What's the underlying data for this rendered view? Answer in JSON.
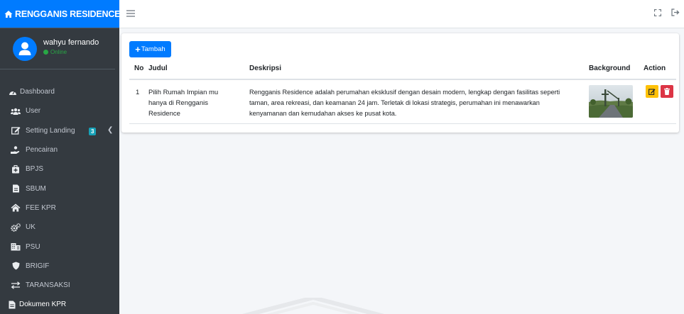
{
  "brand": {
    "title": "RENGGANIS RESIDENCE"
  },
  "user": {
    "name": "wahyu fernando",
    "status": "Online"
  },
  "sidebar": {
    "items": [
      {
        "label": "Dashboard",
        "icon": "tachometer-icon"
      },
      {
        "label": "User",
        "icon": "users-icon"
      },
      {
        "label": "Setting Landing",
        "icon": "edit-icon",
        "badge": "3"
      },
      {
        "label": "Pencairan",
        "icon": "hand-holding-icon"
      },
      {
        "label": "BPJS",
        "icon": "medkit-icon"
      },
      {
        "label": "SBUM",
        "icon": "file-icon"
      },
      {
        "label": "FEE KPR",
        "icon": "home-icon"
      },
      {
        "label": "UK",
        "icon": "cogs-icon"
      },
      {
        "label": "PSU",
        "icon": "building-icon"
      },
      {
        "label": "BRIGIF",
        "icon": "shield-icon"
      },
      {
        "label": "TARANSAKSI",
        "icon": "exchange-icon"
      },
      {
        "label": "Dokumen KPR",
        "icon": "document-icon"
      }
    ]
  },
  "toolbar": {
    "add_label": "Tambah"
  },
  "table": {
    "headers": [
      "No",
      "Judul",
      "Deskripsi",
      "Background",
      "Action"
    ],
    "rows": [
      {
        "no": "1",
        "judul": [
          "Pilih Rumah Impian mu",
          "hanya di Rengganis",
          "Residence"
        ],
        "deskripsi": [
          "Rengganis Residence adalah perumahan eksklusif dengan desain modern, lengkap dengan fasilitas seperti",
          "taman, area rekreasi, dan keamanan 24 jam. Terletak di lokasi strategis, perumahan ini menawarkan",
          "kenyamanan dan kemudahan akses ke pusat kota."
        ]
      }
    ]
  },
  "colors": {
    "primary": "#007bff",
    "sidebar": "#343a40",
    "warning": "#ffc107",
    "danger": "#dc3545",
    "success": "#28a745",
    "info": "#17a2b8"
  }
}
